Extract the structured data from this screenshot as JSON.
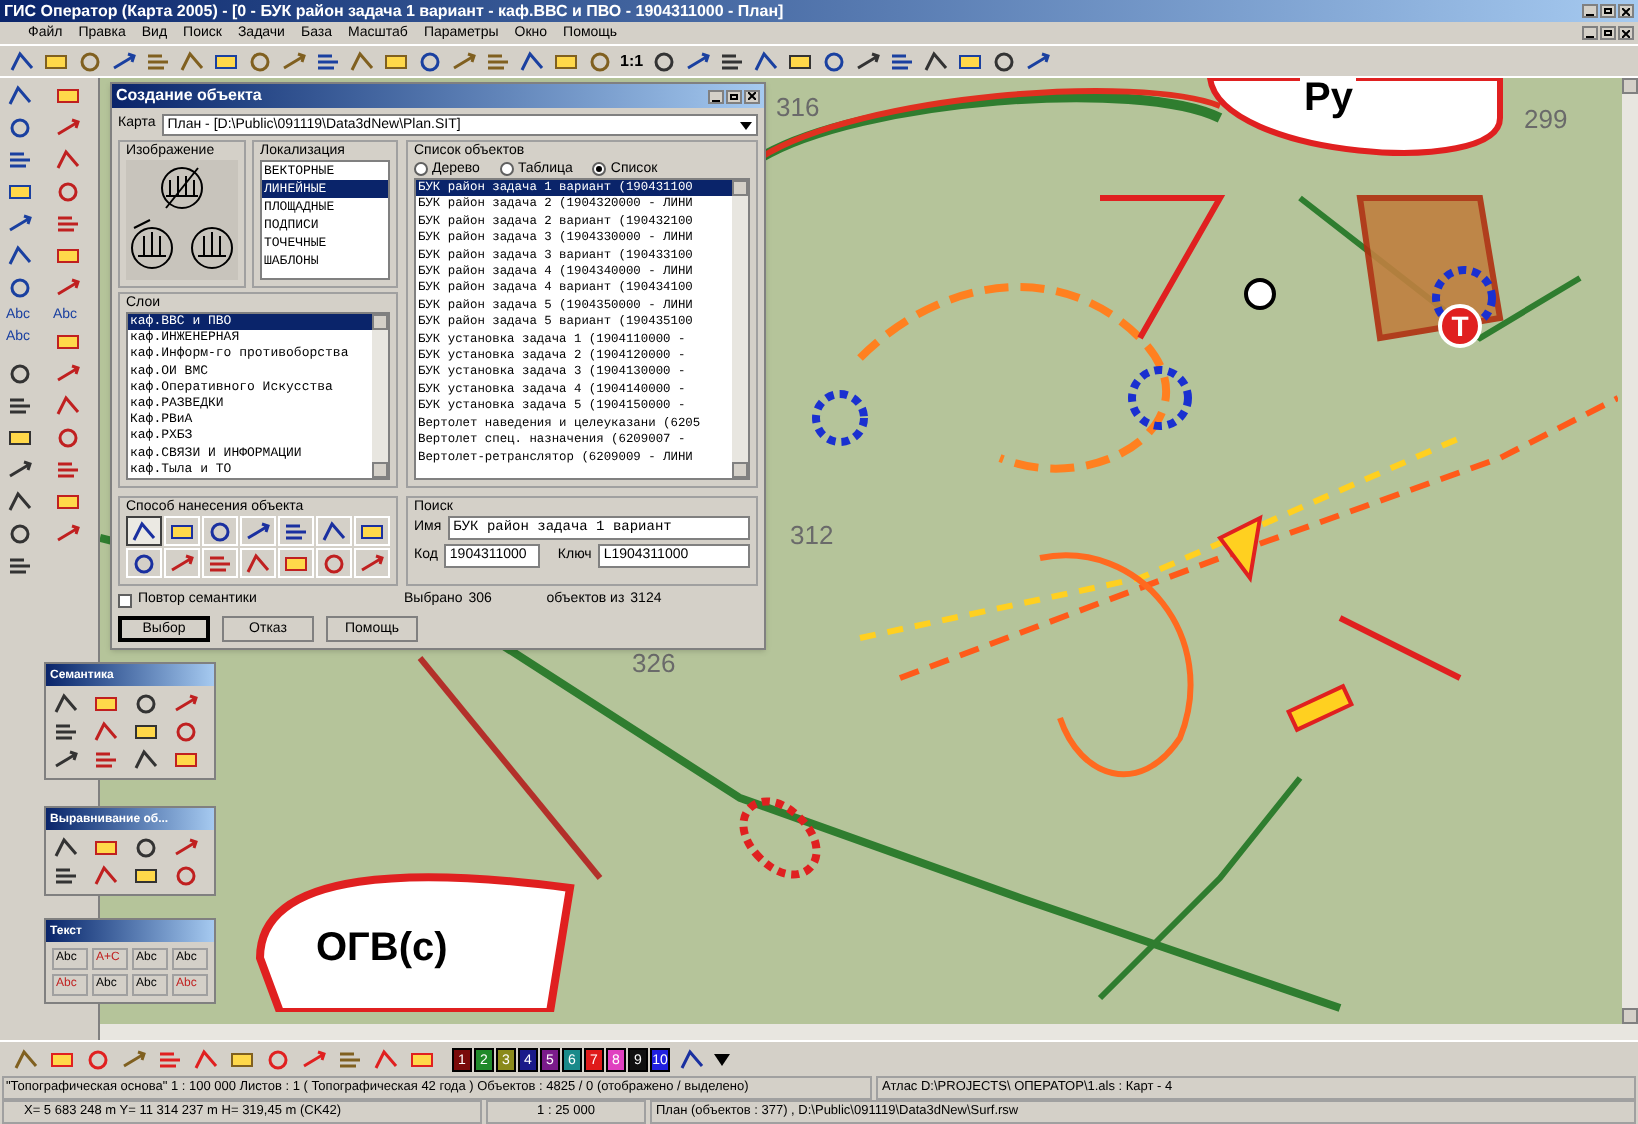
{
  "window": {
    "title": "ГИС Оператор (Карта 2005) - [0 - БУК район задача 1 вариант - каф.ВВС и ПВО - 1904311000 - План]"
  },
  "menu": [
    "Файл",
    "Правка",
    "Вид",
    "Поиск",
    "Задачи",
    "База",
    "Масштаб",
    "Параметры",
    "Окно",
    "Помощь"
  ],
  "toolbar": {
    "scale_button": "1:1"
  },
  "left_tools": {
    "text_buttons": [
      "Abc",
      "Abc",
      "Abc"
    ]
  },
  "map": {
    "labels": [
      {
        "text": "316",
        "kind": "num"
      },
      {
        "text": "Ру",
        "kind": "big"
      },
      {
        "text": "299",
        "kind": "num"
      },
      {
        "text": "Т",
        "kind": "circle"
      },
      {
        "text": "312",
        "kind": "num"
      },
      {
        "text": "326",
        "kind": "num"
      },
      {
        "text": "ОГВ(с)",
        "kind": "big"
      }
    ]
  },
  "dialog": {
    "title": "Создание объекта",
    "map_label": "Карта",
    "map_value": "План - [D:\\Public\\091119\\Data3dNew\\Plan.SIT]",
    "image_group": "Изображение",
    "localization": {
      "label": "Локализация",
      "items": [
        {
          "text": "ВЕКТОРНЫЕ",
          "selected": false
        },
        {
          "text": "ЛИНЕЙНЫЕ",
          "selected": true
        },
        {
          "text": "ПЛОЩАДНЫЕ",
          "selected": false
        },
        {
          "text": "ПОДПИСИ",
          "selected": false
        },
        {
          "text": "ТОЧЕЧНЫЕ",
          "selected": false
        },
        {
          "text": "ШАБЛОНЫ",
          "selected": false
        }
      ]
    },
    "layers": {
      "label": "Слои",
      "items": [
        {
          "text": "каф.ВВС и ПВО",
          "selected": true
        },
        {
          "text": "каф.ИНЖЕНЕРНАЯ",
          "selected": false
        },
        {
          "text": "каф.Информ-го противоборства",
          "selected": false
        },
        {
          "text": "каф.ОИ ВМС",
          "selected": false
        },
        {
          "text": "каф.Оперативного Искусства",
          "selected": false
        },
        {
          "text": "каф.РАЗВЕДКИ",
          "selected": false
        },
        {
          "text": "Каф.РВиА",
          "selected": false
        },
        {
          "text": "каф.РХБЗ",
          "selected": false
        },
        {
          "text": "каф.СВЯЗИ И ИНФОРМАЦИИ",
          "selected": false
        },
        {
          "text": "каф.Тыла и ТО",
          "selected": false
        }
      ]
    },
    "objects": {
      "label": "Список объектов",
      "view_modes": [
        {
          "text": "Дерево",
          "selected": false
        },
        {
          "text": "Таблица",
          "selected": false
        },
        {
          "text": "Список",
          "selected": true
        }
      ],
      "items": [
        {
          "text": "БУК район задача 1 вариант (190431100",
          "selected": true
        },
        {
          "text": "БУК район задача 2 (1904320000 - ЛИНИ",
          "selected": false
        },
        {
          "text": "БУК район задача 2 вариант (190432100",
          "selected": false
        },
        {
          "text": "БУК район задача 3 (1904330000 - ЛИНИ",
          "selected": false
        },
        {
          "text": "БУК район задача 3 вариант (190433100",
          "selected": false
        },
        {
          "text": "БУК район задача 4 (1904340000 - ЛИНИ",
          "selected": false
        },
        {
          "text": "БУК район задача 4 вариант (190434100",
          "selected": false
        },
        {
          "text": "БУК район задача 5 (1904350000 - ЛИНИ",
          "selected": false
        },
        {
          "text": "БУК район задача 5 вариант (190435100",
          "selected": false
        },
        {
          "text": "БУК установка задача 1 (1904110000 -",
          "selected": false
        },
        {
          "text": "БУК установка задача 2 (1904120000 -",
          "selected": false
        },
        {
          "text": "БУК установка задача 3 (1904130000 -",
          "selected": false
        },
        {
          "text": "БУК установка задача 4 (1904140000 -",
          "selected": false
        },
        {
          "text": "БУК установка задача 5 (1904150000 -",
          "selected": false
        },
        {
          "text": "Вертолет наведения и целеуказани (6205",
          "selected": false
        },
        {
          "text": "Вертолет спец. назначения (6209007 -",
          "selected": false
        },
        {
          "text": "Вертолет-ретранслятор (6209009 - ЛИНИ",
          "selected": false
        }
      ]
    },
    "draw_method": {
      "label": "Способ нанесения объекта",
      "buttons": [
        {
          "selected": true
        },
        {
          "selected": false
        },
        {
          "selected": false
        },
        {
          "selected": false
        },
        {
          "selected": false
        },
        {
          "selected": false
        },
        {
          "selected": false
        },
        {
          "selected": false
        },
        {
          "selected": false
        },
        {
          "selected": false
        },
        {
          "selected": false
        },
        {
          "selected": false
        },
        {
          "selected": false
        },
        {
          "selected": false
        }
      ]
    },
    "search": {
      "label": "Поиск",
      "name_label": "Имя",
      "name_value": "БУК район задача 1 вариант",
      "code_label": "Код",
      "code_value": "1904311000",
      "key_label": "Ключ",
      "key_value": "L1904311000"
    },
    "repeat_semantics": {
      "label": "Повтор семантики",
      "checked": false
    },
    "selected_label": "Выбрано",
    "selected_count": "306",
    "total_label": "объектов из",
    "total_count": "3124",
    "buttons": [
      {
        "text": "Выбор",
        "default": true
      },
      {
        "text": "Отказ",
        "default": false
      },
      {
        "text": "Помощь",
        "default": false
      }
    ]
  },
  "palettes": [
    {
      "title": "Семантика",
      "kind": "semantics"
    },
    {
      "title": "Выравнивание об...",
      "kind": "align"
    },
    {
      "title": "Текст",
      "kind": "text",
      "labels": [
        "Abc",
        "A+C",
        "Abc",
        "Abc",
        "Abc",
        "Abc",
        "Abc",
        "Abc"
      ]
    }
  ],
  "color_buttons": [
    {
      "text": "1",
      "color": "#7a0a0a"
    },
    {
      "text": "2",
      "color": "#1f8a2a"
    },
    {
      "text": "3",
      "color": "#8a8a1a"
    },
    {
      "text": "4",
      "color": "#1a1a8a"
    },
    {
      "text": "5",
      "color": "#7a1a8a"
    },
    {
      "text": "6",
      "color": "#1a8a8a"
    },
    {
      "text": "7",
      "color": "#e01a1a"
    },
    {
      "text": "8",
      "color": "#e040c0"
    },
    {
      "text": "9",
      "color": "#101010"
    },
    {
      "text": "10",
      "color": "#2020e0"
    }
  ],
  "status_bar": {
    "row1": [
      "\"Топографическая основа\"  1 : 100 000   Листов : 1   ( Топографическая 42 года )  Объектов : 4825 / 0 (отображено / выделено)",
      "Атлас D:\\PROJECTS\\     ОПЕРАТОР\\1.als : Карт - 4"
    ],
    "row2": [
      "X=  5 683 248 m  Y=  11 314 237 m  H= 319,45 m  (CK42)",
      "1 : 25 000",
      "План  (объектов : 377) , D:\\Public\\091119\\Data3dNew\\Surf.rsw"
    ]
  }
}
